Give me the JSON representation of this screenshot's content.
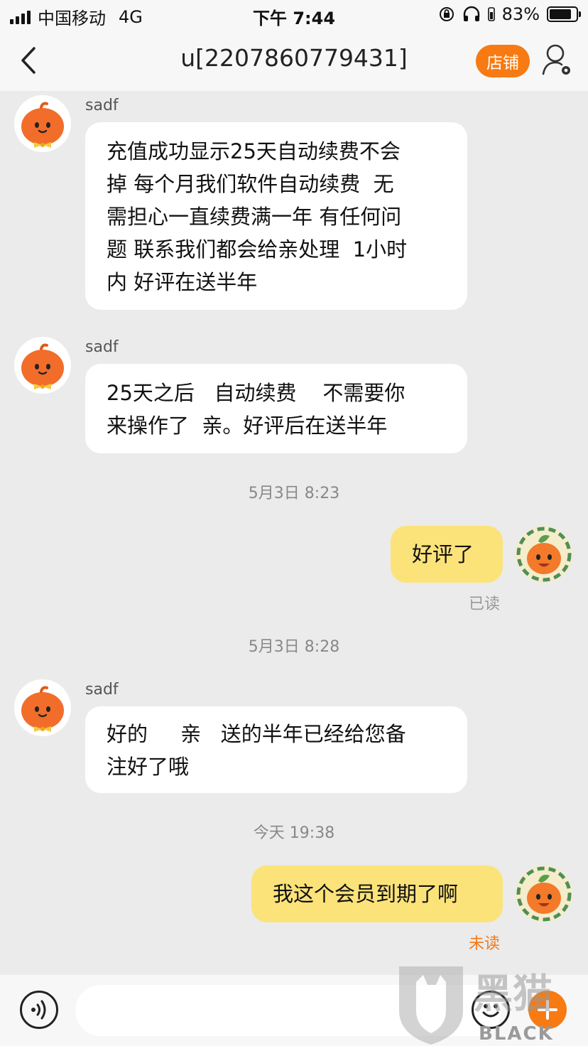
{
  "status_bar": {
    "carrier": "中国移动",
    "network": "4G",
    "time": "下午 7:44",
    "battery": "83%"
  },
  "header": {
    "title": "u[2207860779431]",
    "shop_button": "店铺"
  },
  "messages": [
    {
      "sender": "sadf",
      "lines": [
        "充值成功显示25天自动续费不会",
        "掉 每个月我们软件自动续费  无",
        "需担心一直续费满一年 有任何问",
        "题 联系我们都会给亲处理  1小时",
        "内 好评在送半年"
      ]
    },
    {
      "sender": "sadf",
      "lines": [
        "25天之后   自动续费    不需要你",
        "来操作了  亲。好评后在送半年"
      ]
    },
    {
      "time": "5月3日 8:23"
    },
    {
      "outgoing": "好评了",
      "status": "已读"
    },
    {
      "time": "5月3日 8:28"
    },
    {
      "sender": "sadf",
      "lines": [
        "好的     亲   送的半年已经给您备",
        "注好了哦"
      ]
    },
    {
      "time": "今天 19:38"
    },
    {
      "outgoing": "我这个会员到期了啊",
      "status": "未读"
    }
  ],
  "watermark": {
    "cn": "黑猫",
    "en": "BLACK CAT"
  },
  "colors": {
    "accent": "#f77a12",
    "outgoing_bubble": "#fbe37a",
    "incoming_bubble": "#ffffff",
    "read": "#999999",
    "unread": "#f07a1c"
  }
}
